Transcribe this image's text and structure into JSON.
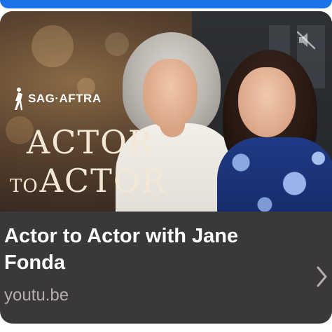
{
  "link_preview": {
    "thumbnail": {
      "logo_text": "SAG·AFTRA",
      "logo_icon": "sag-aftra-figure-icon",
      "title_line1": "ACTOR",
      "title_line2_small": "TO",
      "title_line2_big": "ACTOR",
      "mute_icon": "speaker-muted-icon"
    },
    "title": "Actor to Actor with Jane Fonda",
    "domain": "youtu.be",
    "chevron_icon": "chevron-right-icon"
  },
  "colors": {
    "card_bg": "#3b3839",
    "title_text": "#ffffff",
    "domain_text": "#b3aeaf",
    "bubble_accent": "#1a73e8",
    "thumbnail_title": "#f3e7d6"
  }
}
